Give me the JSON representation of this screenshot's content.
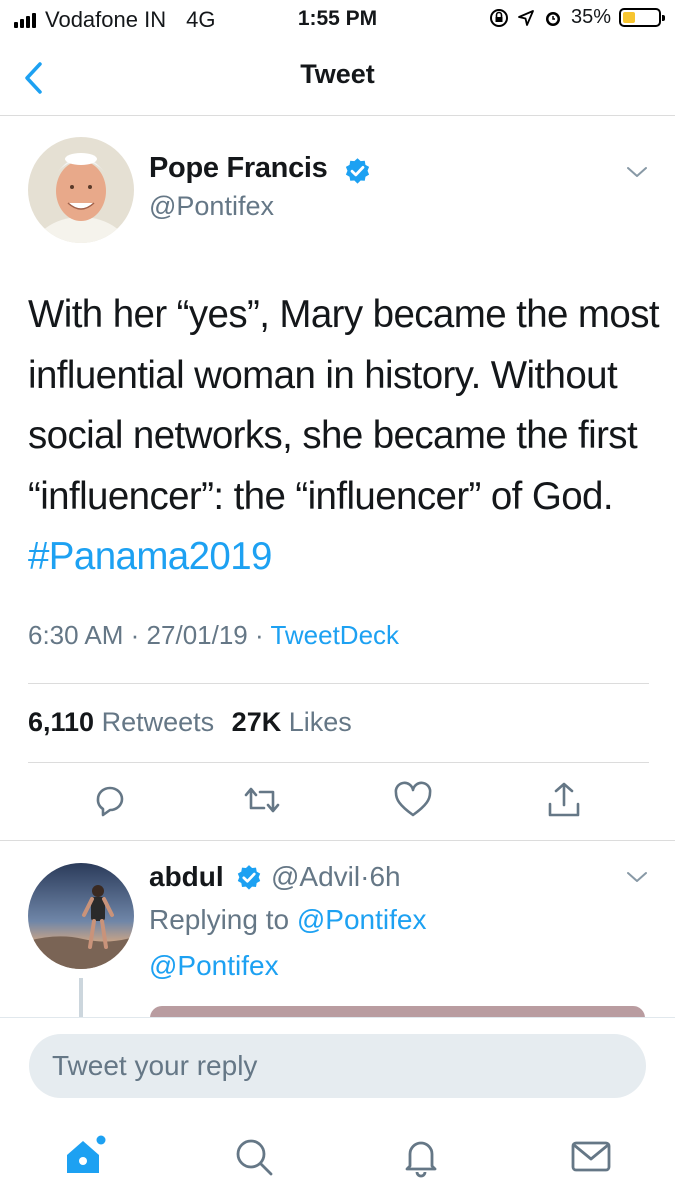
{
  "status_bar": {
    "carrier": "Vodafone IN",
    "network": "4G",
    "time": "1:55 PM",
    "battery_percent": "35%",
    "battery_level": 0.35,
    "icons": [
      "signal-bars-icon",
      "screen-rotation-lock-icon",
      "location-arrow-icon",
      "alarm-icon",
      "battery-icon"
    ]
  },
  "nav": {
    "title": "Tweet",
    "back_icon": "chevron-left-icon"
  },
  "tweet": {
    "display_name": "Pope Francis",
    "verified": true,
    "handle": "@Pontifex",
    "text_before_hashtag": "With her “yes”, Mary became the most influential woman in history. Without social networks, she became the first “influencer”: the “influencer” of God. ",
    "hashtag": "#Panama2019",
    "time": "6:30 AM",
    "date": "27/01/19",
    "separator": "·",
    "source": "TweetDeck",
    "retweets_count": "6,110",
    "retweets_label": "Retweets",
    "likes_count": "27K",
    "likes_label": "Likes",
    "actions": [
      "reply-icon",
      "retweet-icon",
      "like-heart-icon",
      "share-icon"
    ]
  },
  "reply": {
    "display_name": "abdul",
    "verified": true,
    "handle": "@Advil",
    "separator": "·",
    "age": "6h",
    "replying_prefix": "Replying to",
    "replying_to": "@Pontifex",
    "mention": "@Pontifex"
  },
  "composer": {
    "placeholder": "Tweet your reply"
  },
  "tab_bar": {
    "tabs": [
      "home-icon",
      "search-icon",
      "notifications-bell-icon",
      "messages-envelope-icon"
    ],
    "active": "home-icon",
    "home_has_dot": true
  },
  "colors": {
    "accent": "#1da1f2",
    "secondary_text": "#657786",
    "primary_text": "#14171a",
    "divider": "#dcdcdc",
    "composer_bg": "#e6ecf0",
    "battery_fill": "#f7c530"
  }
}
